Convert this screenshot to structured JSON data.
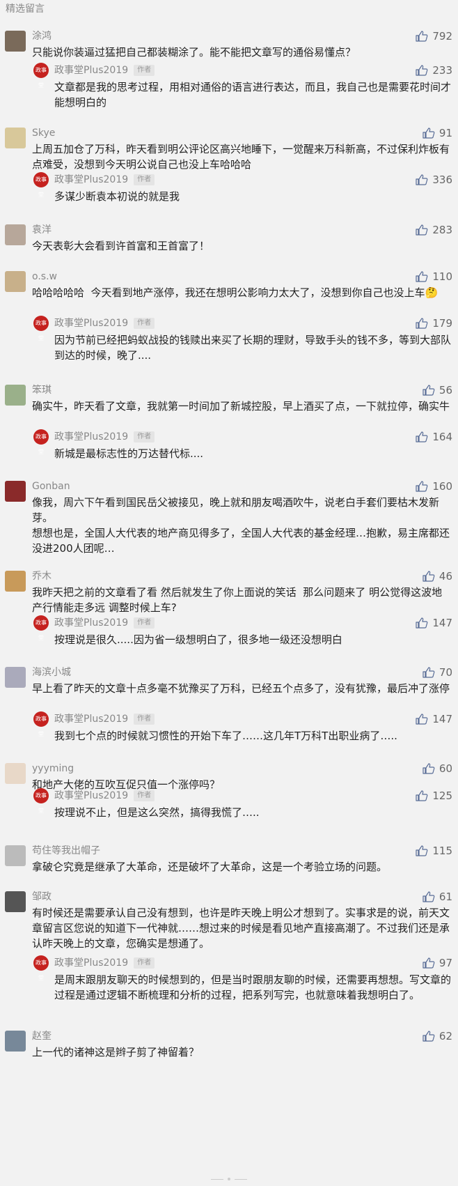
{
  "header": {
    "title": "精选留言"
  },
  "author_label": "作者",
  "reply_author_name": "政事堂Plus2019",
  "reply_avatar_text": "政事堂",
  "comments": [
    {
      "name": "涂鸿",
      "likes": "792",
      "text": "只能说你装逼过猛把自己都装糊涂了。能不能把文章写的通俗易懂点？",
      "reply": {
        "likes": "233",
        "text": "文章都是我的思考过程，用相对通俗的语言进行表达，而且，我自己也是需要花时间才能想明白的"
      }
    },
    {
      "name": "Skye",
      "likes": "91",
      "text": "上周五加仓了万科，昨天看到明公评论区高兴地睡下，一觉醒来万科新高，不过保利炸板有点难受，没想到今天明公说自己也没上车哈哈哈",
      "reply": {
        "likes": "336",
        "text": "多谋少断袁本初说的就是我"
      }
    },
    {
      "name": "袁洋",
      "likes": "283",
      "text": "今天表彰大会看到许首富和王首富了！"
    },
    {
      "name": "o.s.w",
      "likes": "110",
      "text": "哈哈哈哈哈  今天看到地产涨停，我还在想明公影响力太大了，没想到你自己也没上车🤔",
      "reply": {
        "likes": "179",
        "text": "因为节前已经把蚂蚁战投的钱赎出来买了长期的理财，导致手头的钱不多，等到大部队到达的时候，晚了...."
      }
    },
    {
      "name": "笨琪",
      "likes": "56",
      "text": "确实牛，昨天看了文章，我就第一时间加了新城控股，早上酒买了点，一下就拉停，确实牛",
      "reply": {
        "likes": "164",
        "text": "新城是最标志性的万达替代标...."
      }
    },
    {
      "name": "Gonban",
      "likes": "160",
      "text": "像我，周六下午看到国民岳父被接见，晚上就和朋友喝酒吹牛，说老白手套们要枯木发新芽。\n想想也是，全国人大代表的地产商见得多了，全国人大代表的基金经理…抱歉，易主席都还没进200人团呢…"
    },
    {
      "name": "乔木",
      "likes": "46",
      "text": "我昨天把之前的文章看了看 然后就发生了你上面说的笑话  那么问题来了 明公觉得这波地产行情能走多远 调整时候上车?",
      "reply": {
        "likes": "147",
        "text": "按理说是很久.....因为省一级想明白了，很多地一级还没想明白"
      }
    },
    {
      "name": "海滨小城",
      "likes": "70",
      "text": "早上看了昨天的文章十点多毫不犹豫买了万科，已经五个点多了，没有犹豫，最后冲了涨停",
      "reply": {
        "likes": "147",
        "text": "我到七个点的时候就习惯性的开始下车了……这几年T万科T出职业病了….."
      }
    },
    {
      "name": "yyyming",
      "likes": "60",
      "text": "和地产大佬的互吹互促只值一个涨停吗？",
      "reply": {
        "likes": "125",
        "text": "按理说不止，但是这么突然，搞得我慌了….."
      }
    },
    {
      "name": "苟住等我出帽子",
      "likes": "115",
      "text": "拿破仑究竟是继承了大革命，还是破坏了大革命，这是一个考验立场的问题。"
    },
    {
      "name": "邹政",
      "likes": "61",
      "text": "有时候还是需要承认自己没有想到，也许是昨天晚上明公才想到了。实事求是的说，前天文章留言区您说的知道下一代神就……想过来的时候是看见地产直接高潮了。不过我们还是承认昨天晚上的文章，您确实是想通了。",
      "reply": {
        "likes": "97",
        "text": "是周末跟朋友聊天的时候想到的，但是当时跟朋友聊的时候，还需要再想想。写文章的过程是通过逻辑不断梳理和分析的过程，把系列写完，也就意味着我想明白了。"
      }
    },
    {
      "name": "赵奎",
      "likes": "62",
      "text": "上一代的诸神这是辫子剪了神留着？"
    }
  ]
}
